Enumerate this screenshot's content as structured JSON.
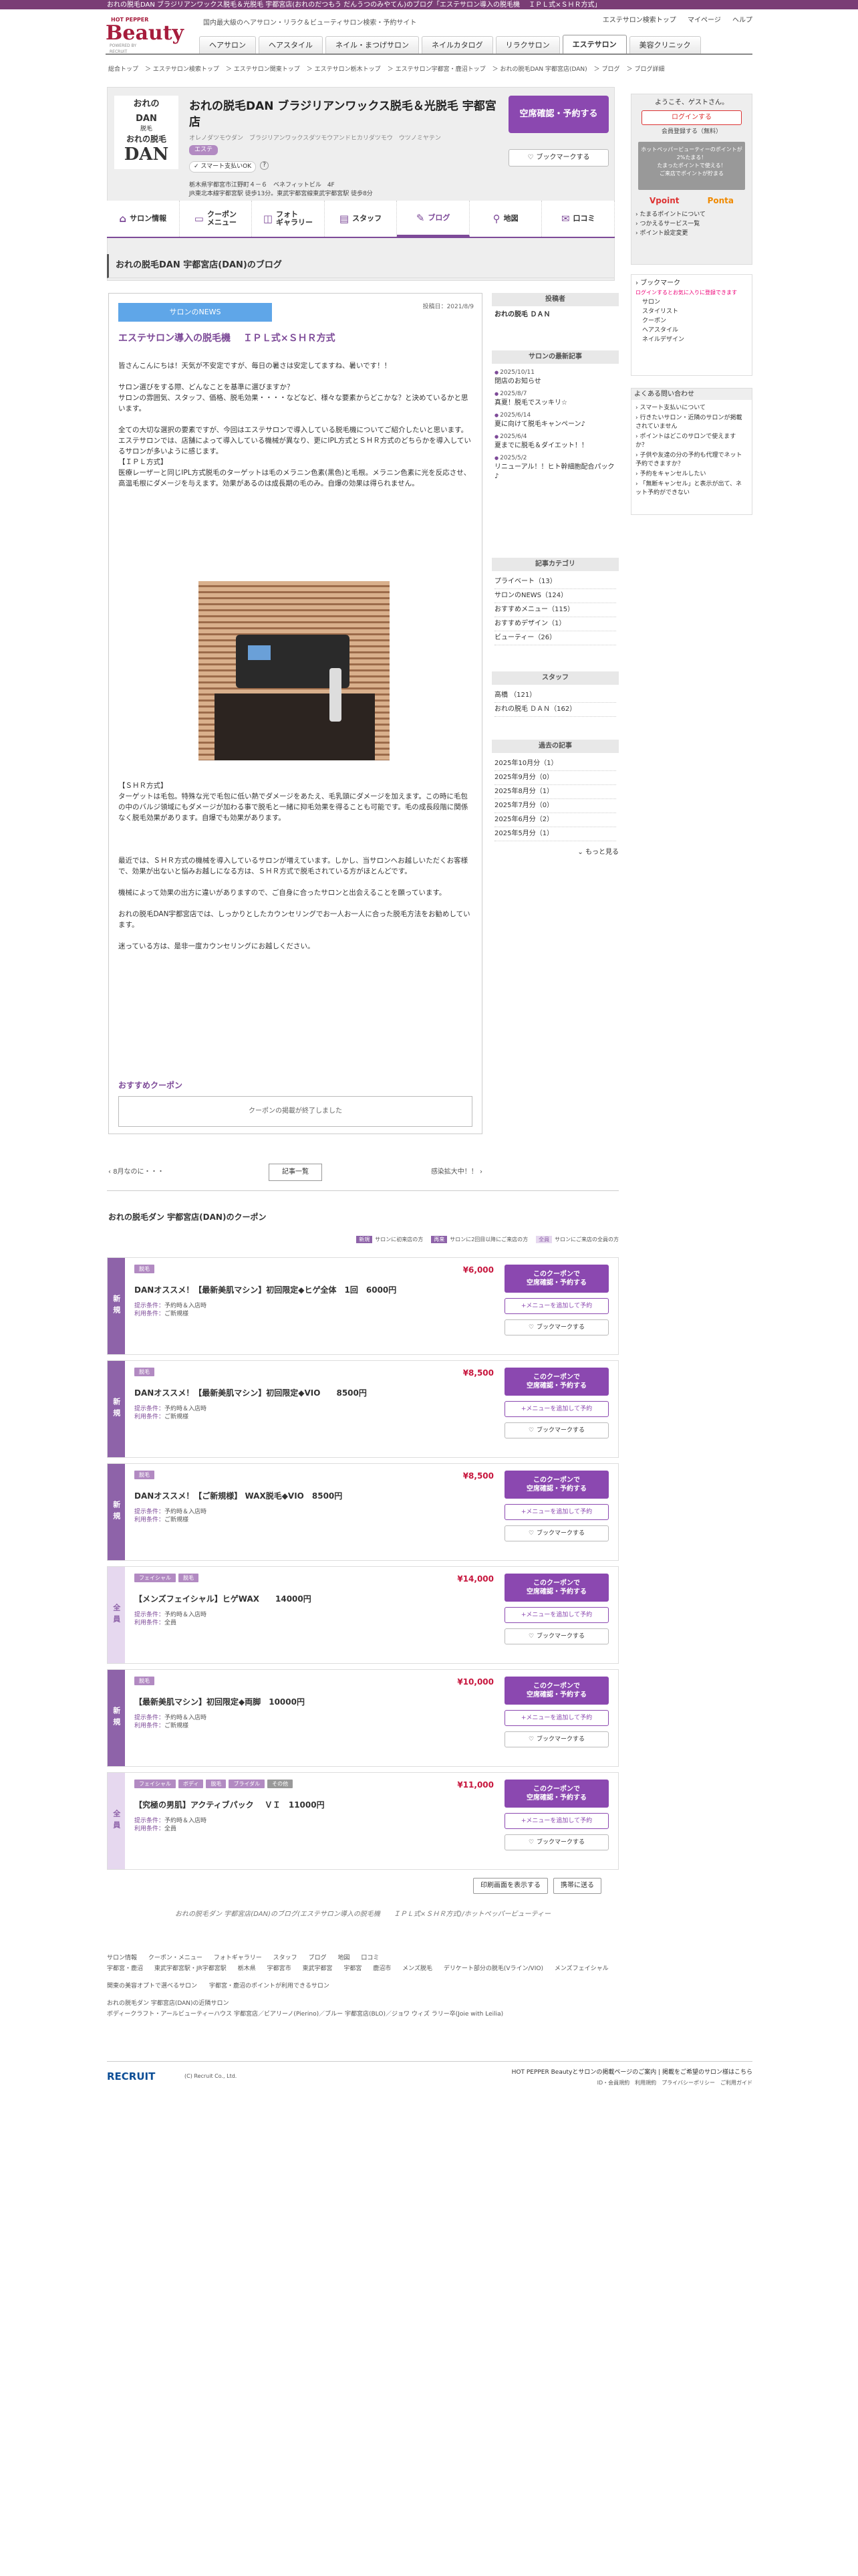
{
  "top_strip": "おれの脱毛DAN ブラジリアンワックス脱毛＆光脱毛 宇都宮店(おれのだつもう だんうつのみやてん)のブログ「エステサロン導入の脱毛機　 ＩＰＬ式×ＳＨＲ方式」",
  "header": {
    "logo_small": "HOT PEPPER",
    "logo_main": "Beauty",
    "logo_by": "POWERED BY RECRUIT",
    "tagline": "国内最大級のヘアサロン・リラク＆ビューティサロン検索・予約サイト",
    "links": [
      "エステサロン検索トップ",
      "マイページ",
      "ヘルプ"
    ]
  },
  "nav": [
    "ヘアサロン",
    "ヘアスタイル",
    "ネイル・まつげサロン",
    "ネイルカタログ",
    "リラクサロン",
    "エステサロン",
    "美容クリニック"
  ],
  "breadcrumbs": [
    "総合トップ",
    "エステサロン検索トップ",
    "エステサロン関東トップ",
    "エステサロン栃木トップ",
    "エステサロン宇都宮・鹿沼トップ",
    "おれの脱毛DAN 宇都宮店(DAN)",
    "ブログ",
    "ブログ詳細"
  ],
  "salon": {
    "logo_top": "おれの",
    "logo_dan": "DAN",
    "logo_sub": "脱毛",
    "logo_big": "おれの脱毛",
    "logo_big2": "DAN",
    "name": "おれの脱毛DAN ブラジリアンワックス脱毛＆光脱毛 宇都宮店",
    "kana": "オレノダツモウダン　ブラジリアンワックスダツモウアンドヒカリダツモウ　ウツノミヤテン",
    "tag": "エステ",
    "option": "スマート支払いOK",
    "address": "栃木県宇都宮市江野町４－６　ベネフィットビル　4F",
    "address2": "JR東北本線宇都宮駅 徒歩13分。東武宇都宮線東武宇都宮駅 徒歩8分",
    "reserve": "空席確認・予約する",
    "bookmark": "ブックマークする"
  },
  "subnav": [
    {
      "label": "サロン情報",
      "icon": "home-icon"
    },
    {
      "label": "クーポン\nメニュー",
      "icon": "coupon-icon"
    },
    {
      "label": "フォト\nギャラリー",
      "icon": "photo-icon"
    },
    {
      "label": "スタッフ",
      "icon": "staff-icon"
    },
    {
      "label": "ブログ",
      "icon": "pen-icon"
    },
    {
      "label": "地図",
      "icon": "map-pin-icon"
    },
    {
      "label": "口コミ",
      "icon": "chat-icon"
    }
  ],
  "login": {
    "guest": "ようこそ、ゲストさん。",
    "login": "ログインする",
    "register": "会員登録する（無料）",
    "promo": "ホットペッパービューティーのポイントが2%たまる！\nたまったポイントで使える！\nご来店でポイントが貯まる",
    "points": [
      "Vpoint",
      "Ponta"
    ],
    "list": [
      "たまるポイントについて",
      "つかえるサービス一覧",
      "ポイント設定変更"
    ]
  },
  "bookmark_box": {
    "title": "ブックマーク",
    "note": "ログインするとお気に入りに登録できます",
    "items": [
      "サロン",
      "スタイリスト",
      "クーポン",
      "ヘアスタイル",
      "ネイルデザイン"
    ]
  },
  "faq": {
    "title": "よくある問い合わせ",
    "items": [
      "スマート支払いについて",
      "行きたいサロン・近隣のサロンが掲載されていません",
      "ポイントはどこのサロンで使えますか？",
      "子供や友達の分の予約も代理でネット予約できますか？",
      "予約をキャンセルしたい",
      "「無断キャンセル」と表示が出て、ネット予約ができない"
    ]
  },
  "page_title": "おれの脱毛DAN 宇都宮店(DAN)のブログ",
  "article": {
    "badge": "サロンのNEWS",
    "date": "投稿日：2021/8/9",
    "title": "エステサロン導入の脱毛機　 ＩＰＬ式×ＳＨＲ方式",
    "p1": "皆さんこんにちは！天気が不安定ですが、毎日の暑さは安定してますね、暑いです！！\n\nサロン選びをする際、どんなことを基準に選びますか？\nサロンの雰囲気、スタッフ、価格、脱毛効果・・・・などなど、様々な要素からどこかな？と決めているかと思います。\n\n全ての大切な選択の要素ですが、今回はエステサロンで導入している脱毛機についてご紹介したいと思います。\nエステサロンでは、店舗によって導入している機械が異なり、更にIPL方式とＳＨＲ方式のどちらかを導入しているサロンが多いように感じます。\n【ＩＰＬ方式】\n医療レーザーと同じIPL方式脱毛のターゲットは毛のメラニン色素(黒色)と毛根。メラニン色素に光を反応させ、高温毛根にダメージを与えます。効果があるのは成長期の毛のみ。自爆の効果は得られません。",
    "p2": "【ＳＨＲ方式】\nターゲットは毛包。特殊な光で毛包に低い熱でダメージをあたえ、毛乳頭にダメージを加えます。この時に毛包の中のバルジ領域にもダメージが加わる事で脱毛と一緒に抑毛効果を得ることも可能です。毛の成長段階に関係なく脱毛効果があります。自爆でも効果があります。\n\n\n\n最近では、ＳＨＲ方式の機械を導入しているサロンが増えています。しかし、当サロンへお越しいただくお客様で、効果が出ないと悩みお越しになる方は、ＳＨＲ方式で脱毛されている方がほとんどです。\n\n機械によって効果の出方に違いがありますので、ご自身に合ったサロンと出会えることを願っています。\n\nおれの脱毛DAN宇都宮店では、しっかりとしたカウンセリングでお一人お一人に合った脱毛方法をお勧めしています。\n\n迷っている方は、是非一度カウンセリングにお越しください。",
    "coupon_title": "おすすめクーポン",
    "coupon_end": "クーポンの掲載が終了しました"
  },
  "sidebar": {
    "poster_title": "投稿者",
    "poster": "おれの脱毛 ＤＡＮ",
    "recent_title": "サロンの最新記事",
    "recent": [
      {
        "date": "2025/10/11",
        "title": "閉店のお知らせ"
      },
      {
        "date": "2025/8/7",
        "title": "真夏！脱毛でスッキリ☆"
      },
      {
        "date": "2025/6/14",
        "title": "夏に向けて脱毛キャンペーン♪"
      },
      {
        "date": "2025/6/4",
        "title": "夏までに脱毛＆ダイエット！！"
      },
      {
        "date": "2025/5/2",
        "title": "リニューアル！！ヒト幹細胞配合パック♪"
      }
    ],
    "cat_title": "記事カテゴリ",
    "cats": [
      "プライベート（13）",
      "サロンのNEWS（124）",
      "おすすめメニュー（115）",
      "おすすめデザイン（1）",
      "ビューティー（26）"
    ],
    "staff_title": "スタッフ",
    "staff": [
      "高橋 （121）",
      "おれの脱毛 ＤＡＮ（162）"
    ],
    "archive_title": "過去の記事",
    "archive": [
      "2025年10月分（1）",
      "2025年9月分（0）",
      "2025年8月分（1）",
      "2025年7月分（0）",
      "2025年6月分（2）",
      "2025年5月分（1）"
    ],
    "more": "もっと見る"
  },
  "pager": {
    "prev": "8月なのに・・・",
    "list": "記事一覧",
    "next": "感染拡大中！！"
  },
  "coupons_head": "おれの脱毛ダン 宇都宮店(DAN)のクーポン",
  "legend": [
    {
      "badge": "新規",
      "text": "サロンに初来店の方"
    },
    {
      "badge": "再来",
      "text": "サロンに2回目以降にご来店の方"
    },
    {
      "badge": "全員",
      "text": "サロンにご来店の全員の方"
    }
  ],
  "coupon_labels": {
    "cond1": "提示条件：",
    "cond2": "利用条件：",
    "reserve": "このクーポンで\n空席確認・予約する",
    "add": "+メニューを追加して予約",
    "bookmark": "ブックマークする"
  },
  "coupons": [
    {
      "side": "新規",
      "tags": [
        "脱毛"
      ],
      "price": "¥6,000",
      "name": "DANオススメ！【最新美肌マシン】初回限定◆ヒゲ全体　1回　6000円",
      "c1": "予約時＆入店時",
      "c2": "ご新規様"
    },
    {
      "side": "新規",
      "tags": [
        "脱毛"
      ],
      "price": "¥8,500",
      "name": "DANオススメ！【最新美肌マシン】初回限定◆VIO　　8500円",
      "c1": "予約時＆入店時",
      "c2": "ご新規様"
    },
    {
      "side": "新規",
      "tags": [
        "脱毛"
      ],
      "price": "¥8,500",
      "name": "DANオススメ！【ご新規様】 WAX脱毛◆VIO　8500円",
      "c1": "予約時＆入店時",
      "c2": "ご新規様"
    },
    {
      "side": "全員",
      "tags": [
        "フェイシャル",
        "脱毛"
      ],
      "price": "¥14,000",
      "name": "【メンズフェイシャル】ヒゲWAX　　14000円",
      "c1": "予約時＆入店時",
      "c2": "全員"
    },
    {
      "side": "新規",
      "tags": [
        "脱毛"
      ],
      "price": "¥10,000",
      "name": "【最新美肌マシン】初回限定◆両脚　10000円",
      "c1": "予約時＆入店時",
      "c2": "ご新規様"
    },
    {
      "side": "全員",
      "tags": [
        "フェイシャル",
        "ボディ",
        "脱毛",
        "ブライダル",
        "その他"
      ],
      "price": "¥11,000",
      "name": "【究極の男肌】アクティブパック　 ＶＩ　11000円",
      "c1": "予約時＆入店時",
      "c2": "全員"
    }
  ],
  "print": [
    "印刷画面を表示する",
    "携帯に送る"
  ],
  "footer_caption": "おれの脱毛ダン 宇都宮店(DAN)のブログ(エステサロン導入の脱毛機　　ＩＰＬ式×ＳＨＲ方式)/ホットペッパービューティー",
  "footer_links": [
    "サロン情報",
    "クーポン・メニュー",
    "フォトギャラリー",
    "スタッフ",
    "ブログ",
    "地図",
    "口コミ"
  ],
  "footer_links2": [
    "宇都宮・鹿沼",
    "東武宇都宮駅・JR宇都宮駅",
    "栃木県",
    "宇都宮市",
    "東武宇都宮",
    "宇都宮",
    "鹿沼市",
    "メンズ脱毛",
    "デリケート部分の脱毛(Vライン/VIO)",
    "メンズフェイシャル"
  ],
  "footer_links3": "関東の美容オプトで選べるサロン　　宇都宮・鹿沼のポイントが利用できるサロン",
  "footer_links4": "おれの脱毛ダン 宇都宮店(DAN)の近隣サロン\nボディークラフト・アールビューティーハウス 宇都宮店／ビアリーノ(Pierino)／ブルー 宇都宮店(BLO)／ジョワ ウィズ ラリー卒(Joie with Leilia)",
  "recruit": "RECRUIT",
  "copyright": "(C) Recruit Co., Ltd.",
  "footer_right": [
    "HOT PEPPER Beautyとサロンの掲載ページのご案内",
    "掲載をご希望のサロン様はこちら"
  ],
  "footer_right2": [
    "ID・会員規約",
    "利用規約",
    "プライバシーポリシー",
    "ご利用ガイド"
  ]
}
